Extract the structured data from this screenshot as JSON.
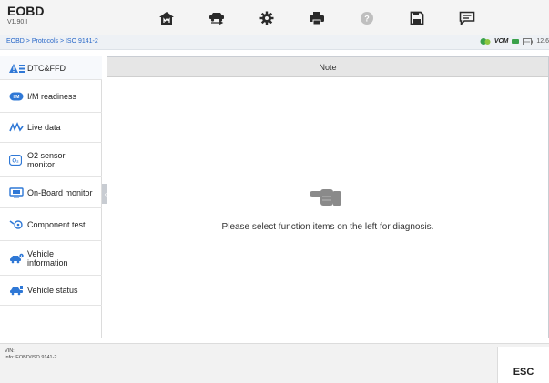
{
  "app": {
    "title": "EOBD",
    "version": "V1.90.I"
  },
  "toolbar": {
    "items": [
      {
        "icon": "home-icon"
      },
      {
        "icon": "vehicle-swap-icon"
      },
      {
        "icon": "settings-icon"
      },
      {
        "icon": "print-icon"
      },
      {
        "icon": "help-icon"
      },
      {
        "icon": "save-icon"
      },
      {
        "icon": "message-icon"
      }
    ]
  },
  "breadcrumb": {
    "text": "EOBD > Protocols > ISO 9141-2"
  },
  "status": {
    "vcm_label": "VCM",
    "voltage": "12.6"
  },
  "sidebar": {
    "items": [
      {
        "label": "DTC&FFD",
        "icon": "dtc-icon"
      },
      {
        "label": "I/M readiness",
        "icon": "im-readiness-icon"
      },
      {
        "label": "Live data",
        "icon": "live-data-icon"
      },
      {
        "label": "O2 sensor monitor",
        "icon": "o2-sensor-icon"
      },
      {
        "label": "On-Board monitor",
        "icon": "onboard-monitor-icon"
      },
      {
        "label": "Component test",
        "icon": "component-test-icon"
      },
      {
        "label": "Vehicle information",
        "icon": "vehicle-info-icon"
      },
      {
        "label": "Vehicle status",
        "icon": "vehicle-status-icon"
      }
    ]
  },
  "main": {
    "header": "Note",
    "message": "Please select function items on the left for diagnosis."
  },
  "footer": {
    "vin": "VIN:",
    "info": "Info: EOBD/ISO 9141-2",
    "esc_label": "ESC"
  },
  "colors": {
    "accent": "#2767c8",
    "toolbar_icon": "#2a2a2a",
    "header_bg": "#e6e6e6"
  }
}
